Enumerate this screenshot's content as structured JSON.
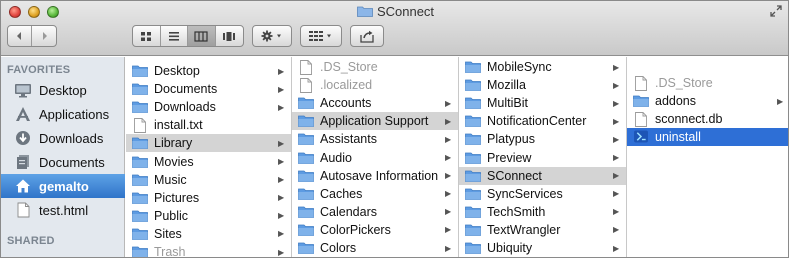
{
  "window": {
    "title": "SConnect"
  },
  "toolbar": {
    "back_icon": "chevron-left-icon",
    "forward_icon": "chevron-right-icon",
    "views": [
      "icon-view-icon",
      "list-view-icon",
      "column-view-icon",
      "coverflow-view-icon"
    ],
    "active_view": 2,
    "action_icon": "gear-icon",
    "arrange_icon": "arrange-icon",
    "share_icon": "share-icon"
  },
  "sidebar": {
    "favorites_header": "FAVORITES",
    "shared_header": "SHARED",
    "items": [
      {
        "label": "Desktop",
        "icon": "desktop-icon"
      },
      {
        "label": "Applications",
        "icon": "applications-icon"
      },
      {
        "label": "Downloads",
        "icon": "downloads-icon"
      },
      {
        "label": "Documents",
        "icon": "documents-icon"
      },
      {
        "label": "gemalto",
        "icon": "home-icon",
        "selected": true
      },
      {
        "label": "test.html",
        "icon": "document-icon"
      }
    ]
  },
  "columns": [
    {
      "items": [
        {
          "label": "Desktop",
          "type": "folder",
          "arrow": true
        },
        {
          "label": "Documents",
          "type": "folder",
          "arrow": true
        },
        {
          "label": "Downloads",
          "type": "folder",
          "arrow": true
        },
        {
          "label": "install.txt",
          "type": "file",
          "arrow": false
        },
        {
          "label": "Library",
          "type": "folder",
          "arrow": true,
          "selected": "grey"
        },
        {
          "label": "Movies",
          "type": "folder",
          "arrow": true
        },
        {
          "label": "Music",
          "type": "folder",
          "arrow": true
        },
        {
          "label": "Pictures",
          "type": "folder",
          "arrow": true
        },
        {
          "label": "Public",
          "type": "folder",
          "arrow": true
        },
        {
          "label": "Sites",
          "type": "folder",
          "arrow": true
        },
        {
          "label": "Trash",
          "type": "folder",
          "arrow": true,
          "dim": true
        }
      ]
    },
    {
      "items": [
        {
          "label": ".DS_Store",
          "type": "file",
          "arrow": false,
          "dim": true
        },
        {
          "label": ".localized",
          "type": "file",
          "arrow": false,
          "dim": true
        },
        {
          "label": "Accounts",
          "type": "folder",
          "arrow": true
        },
        {
          "label": "Application Support",
          "type": "folder",
          "arrow": true,
          "selected": "grey"
        },
        {
          "label": "Assistants",
          "type": "folder",
          "arrow": true
        },
        {
          "label": "Audio",
          "type": "folder",
          "arrow": true
        },
        {
          "label": "Autosave Information",
          "type": "folder",
          "arrow": true
        },
        {
          "label": "Caches",
          "type": "folder",
          "arrow": true
        },
        {
          "label": "Calendars",
          "type": "folder",
          "arrow": true
        },
        {
          "label": "ColorPickers",
          "type": "folder",
          "arrow": true
        },
        {
          "label": "Colors",
          "type": "folder",
          "arrow": true
        }
      ]
    },
    {
      "items": [
        {
          "label": "MobileSync",
          "type": "folder",
          "arrow": true
        },
        {
          "label": "Mozilla",
          "type": "folder",
          "arrow": true
        },
        {
          "label": "MultiBit",
          "type": "folder",
          "arrow": true
        },
        {
          "label": "NotificationCenter",
          "type": "folder",
          "arrow": true
        },
        {
          "label": "Platypus",
          "type": "folder",
          "arrow": true
        },
        {
          "label": "Preview",
          "type": "folder",
          "arrow": true
        },
        {
          "label": "SConnect",
          "type": "folder",
          "arrow": true,
          "selected": "grey"
        },
        {
          "label": "SyncServices",
          "type": "folder",
          "arrow": true
        },
        {
          "label": "TechSmith",
          "type": "folder",
          "arrow": true
        },
        {
          "label": "TextWrangler",
          "type": "folder",
          "arrow": true
        },
        {
          "label": "Ubiquity",
          "type": "folder",
          "arrow": true
        }
      ]
    },
    {
      "items": [
        {
          "label": ".DS_Store",
          "type": "file",
          "arrow": false,
          "dim": true
        },
        {
          "label": "addons",
          "type": "folder",
          "arrow": true
        },
        {
          "label": "sconnect.db",
          "type": "file",
          "arrow": false
        },
        {
          "label": "uninstall",
          "type": "script",
          "arrow": false,
          "selected": "blue"
        }
      ]
    }
  ],
  "colors": {
    "folder": "#5d9be2",
    "selection_blue": "#2e6fd6",
    "selection_grey": "#d4d4d4",
    "sidebar_bg": "#e3e8ee"
  }
}
